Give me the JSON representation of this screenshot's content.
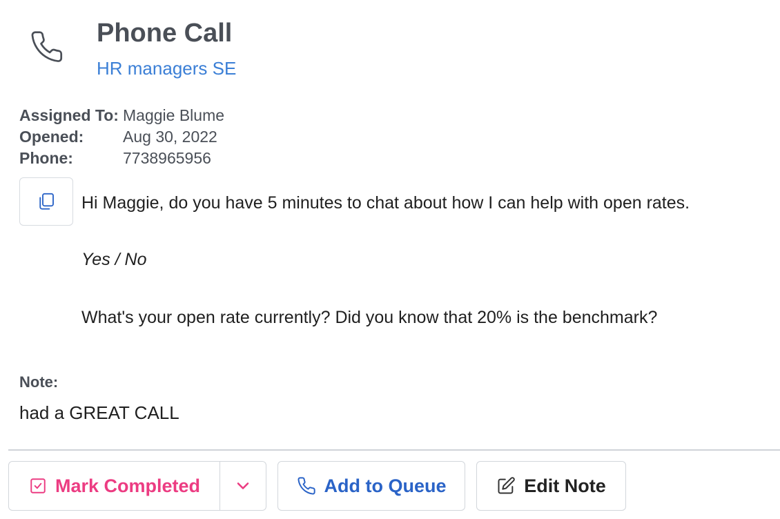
{
  "header": {
    "title": "Phone Call",
    "subtitle": "HR managers SE",
    "icon": "phone-icon"
  },
  "details": [
    {
      "label": "Assigned To:",
      "value": "Maggie Blume"
    },
    {
      "label": "Opened:",
      "value": "Aug 30, 2022"
    },
    {
      "label": "Phone:",
      "value": "7738965956"
    }
  ],
  "script": {
    "copy_icon": "copy-icon",
    "line1": "Hi Maggie, do you have 5 minutes to chat about how I can help with open rates.",
    "line2": "Yes / No",
    "line3": "What's your open rate currently? Did you know that 20% is the benchmark?"
  },
  "note": {
    "label": "Note:",
    "text": "had a GREAT CALL"
  },
  "actions": {
    "mark_completed": "Mark Completed",
    "add_to_queue": "Add to Queue",
    "edit_note": "Edit Note"
  },
  "colors": {
    "title": "#4a4f57",
    "link": "#3b7fd6",
    "pink": "#ec3c82",
    "blue": "#2a63c7"
  }
}
